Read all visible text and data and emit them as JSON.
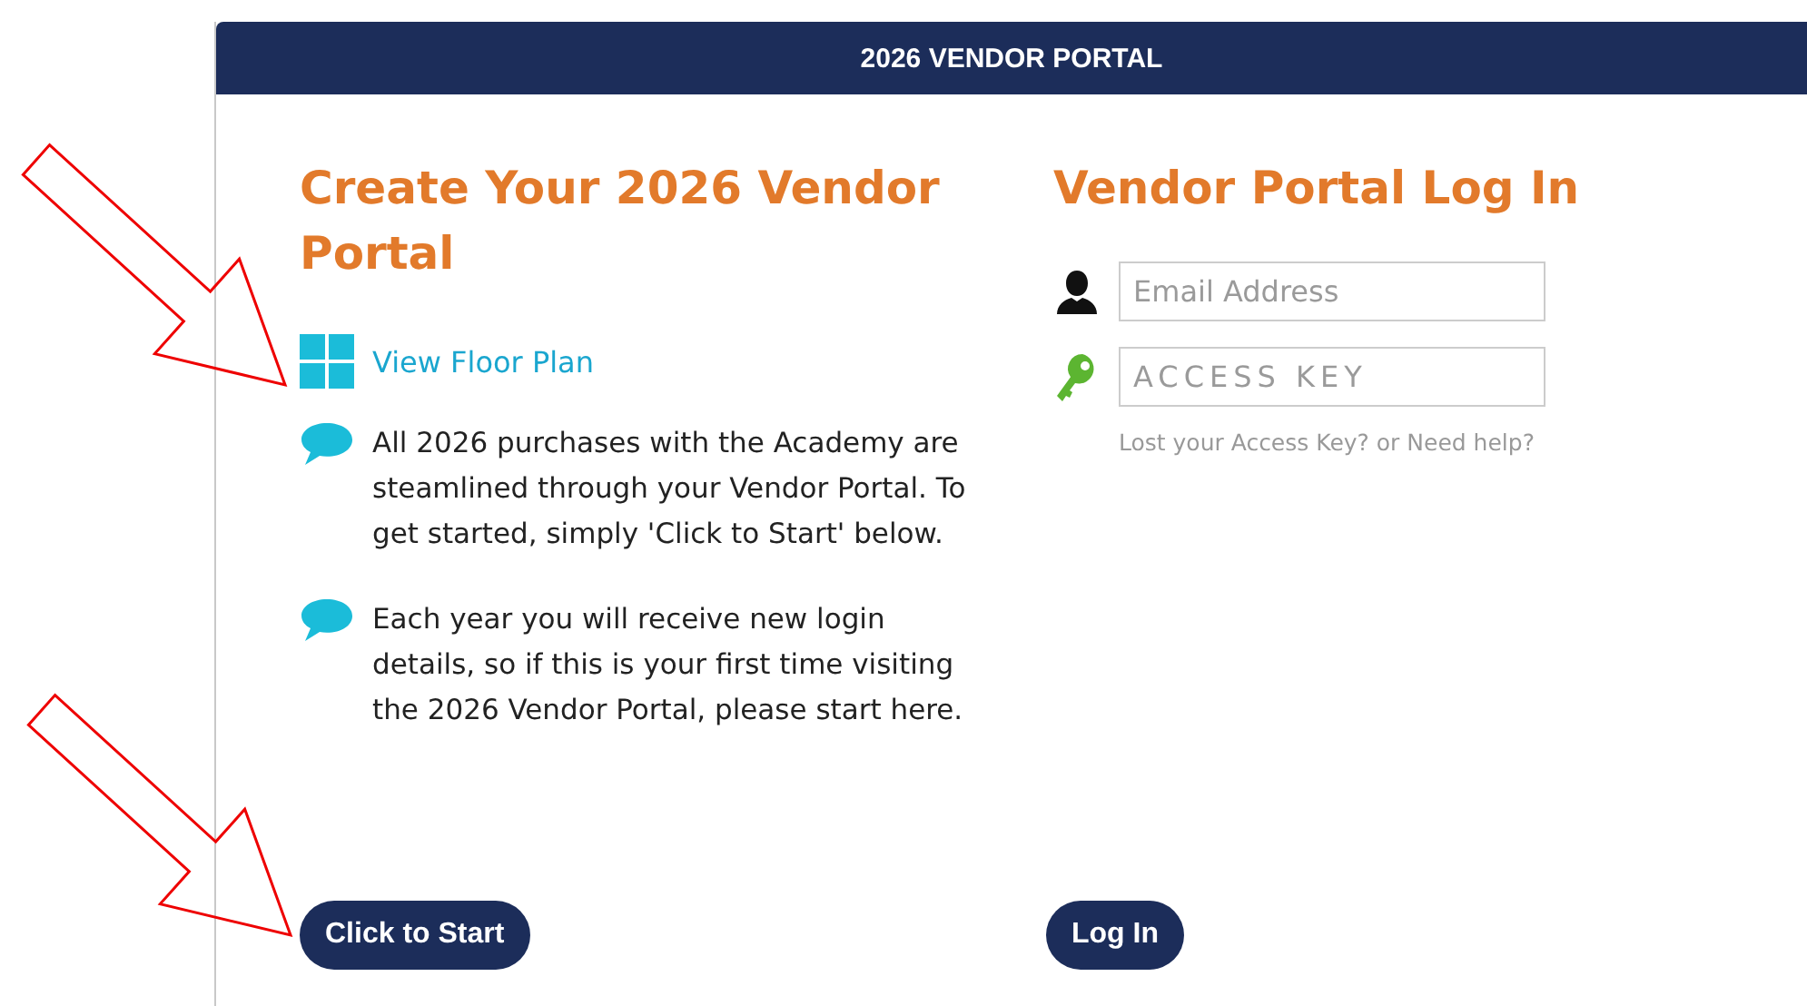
{
  "header": {
    "title": "2026 VENDOR PORTAL"
  },
  "create": {
    "title": "Create Your 2026 Vendor Portal",
    "floor_plan_link": "View Floor Plan",
    "notes": [
      "All 2026 purchases with the Academy are steamlined through your Vendor Portal. To get started, simply 'Click to Start' below.",
      "Each year you will receive new login details, so if this is your first time visiting the 2026 Vendor Portal, please start here."
    ],
    "button": "Click to Start"
  },
  "login": {
    "title": "Vendor Portal Log In",
    "fields": [
      {
        "kind": "email",
        "placeholder": "Email Address"
      },
      {
        "kind": "key",
        "placeholder": "ACCESS KEY"
      }
    ],
    "help_link": "Lost your Access Key? or Need help?",
    "button": "Log In"
  }
}
